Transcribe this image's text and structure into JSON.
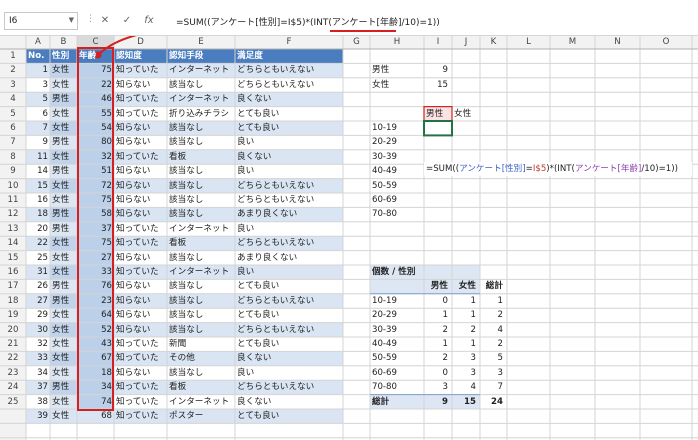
{
  "formula_bar": {
    "name_box": "I6",
    "cancel_icon": "✕",
    "enter_icon": "✓",
    "fx_label": "fx",
    "formula": "=SUM((アンケート[性別]=I$5)*(INT(アンケート[年齢]/10)=1))"
  },
  "columns": [
    "A",
    "B",
    "C",
    "D",
    "E",
    "F",
    "G",
    "H",
    "I",
    "J",
    "K",
    "L",
    "M",
    "N",
    "O"
  ],
  "table": {
    "headers": [
      "No.",
      "性別",
      "年齢",
      "認知度",
      "認知手段",
      "満足度"
    ],
    "rows": [
      [
        "1",
        "女性",
        "75",
        "知っていた",
        "インターネット",
        "どちらともいえない"
      ],
      [
        "3",
        "女性",
        "22",
        "知らない",
        "該当なし",
        "どちらともいえない"
      ],
      [
        "5",
        "男性",
        "46",
        "知っていた",
        "インターネット",
        "良くない"
      ],
      [
        "6",
        "女性",
        "55",
        "知っていた",
        "折り込みチラシ",
        "とても良い"
      ],
      [
        "7",
        "女性",
        "54",
        "知らない",
        "該当なし",
        "とても良い"
      ],
      [
        "9",
        "男性",
        "80",
        "知らない",
        "該当なし",
        "良い"
      ],
      [
        "11",
        "女性",
        "32",
        "知っていた",
        "看板",
        "良くない"
      ],
      [
        "14",
        "男性",
        "51",
        "知らない",
        "該当なし",
        "良い"
      ],
      [
        "15",
        "女性",
        "72",
        "知らない",
        "該当なし",
        "どちらともいえない"
      ],
      [
        "16",
        "女性",
        "75",
        "知らない",
        "該当なし",
        "どちらともいえない"
      ],
      [
        "18",
        "男性",
        "58",
        "知らない",
        "該当なし",
        "あまり良くない"
      ],
      [
        "20",
        "男性",
        "37",
        "知っていた",
        "インターネット",
        "良い"
      ],
      [
        "22",
        "女性",
        "75",
        "知っていた",
        "看板",
        "どちらともいえない"
      ],
      [
        "25",
        "女性",
        "27",
        "知らない",
        "該当なし",
        "あまり良くない"
      ],
      [
        "31",
        "女性",
        "33",
        "知っていた",
        "インターネット",
        "良い"
      ],
      [
        "26",
        "男性",
        "76",
        "知らない",
        "該当なし",
        "とても良い"
      ],
      [
        "27",
        "男性",
        "23",
        "知らない",
        "該当なし",
        "どちらともいえない"
      ],
      [
        "29",
        "女性",
        "64",
        "知らない",
        "該当なし",
        "とても良い"
      ],
      [
        "30",
        "女性",
        "52",
        "知らない",
        "該当なし",
        "どちらともいえない"
      ],
      [
        "32",
        "女性",
        "43",
        "知っていた",
        "新聞",
        "とても良い"
      ],
      [
        "33",
        "女性",
        "67",
        "知っていた",
        "その他",
        "良くない"
      ],
      [
        "34",
        "女性",
        "18",
        "知らない",
        "該当なし",
        "良い"
      ],
      [
        "37",
        "男性",
        "34",
        "知っていた",
        "看板",
        "どちらともいえない"
      ],
      [
        "38",
        "女性",
        "74",
        "知っていた",
        "インターネット",
        "良くない"
      ],
      [
        "39",
        "女性",
        "68",
        "知っていた",
        "ポスター",
        "とても良い"
      ]
    ]
  },
  "summary": {
    "labels": [
      "男性",
      "女性"
    ],
    "values": [
      "9",
      "15"
    ]
  },
  "crosstab": {
    "sex_headers": [
      "男性",
      "女性"
    ],
    "ranges": [
      "10-19",
      "20-29",
      "30-39",
      "40-49",
      "50-59",
      "60-69",
      "70-80"
    ]
  },
  "live_formula": {
    "prefix": "=SUM((",
    "ref1": "アンケート[性別]",
    "mid1": "=",
    "ref2": "I$5",
    "mid2": ")*(INT(",
    "ref3": "アンケート[年齢]",
    "suffix": "/10)=1))"
  },
  "pivot": {
    "title": "個数 / 性別",
    "headers": [
      "男性",
      "女性",
      "総計"
    ],
    "rows": [
      {
        "label": "10-19",
        "values": [
          "0",
          "1",
          "1"
        ]
      },
      {
        "label": "20-29",
        "values": [
          "1",
          "1",
          "2"
        ]
      },
      {
        "label": "30-39",
        "values": [
          "2",
          "2",
          "4"
        ]
      },
      {
        "label": "40-49",
        "values": [
          "1",
          "1",
          "2"
        ]
      },
      {
        "label": "50-59",
        "values": [
          "2",
          "3",
          "5"
        ]
      },
      {
        "label": "60-69",
        "values": [
          "0",
          "3",
          "3"
        ]
      },
      {
        "label": "70-80",
        "values": [
          "3",
          "4",
          "7"
        ]
      }
    ],
    "total_label": "総計",
    "total_values": [
      "9",
      "15",
      "24"
    ]
  },
  "colors": {
    "table_header": "#4a7cc0",
    "band_light": "#d9e5f3",
    "band_dark": "#bcd0ea",
    "highlight_red": "#d32020",
    "ref_blue": "#3b62c6",
    "ref_purple": "#8a3fb0"
  }
}
